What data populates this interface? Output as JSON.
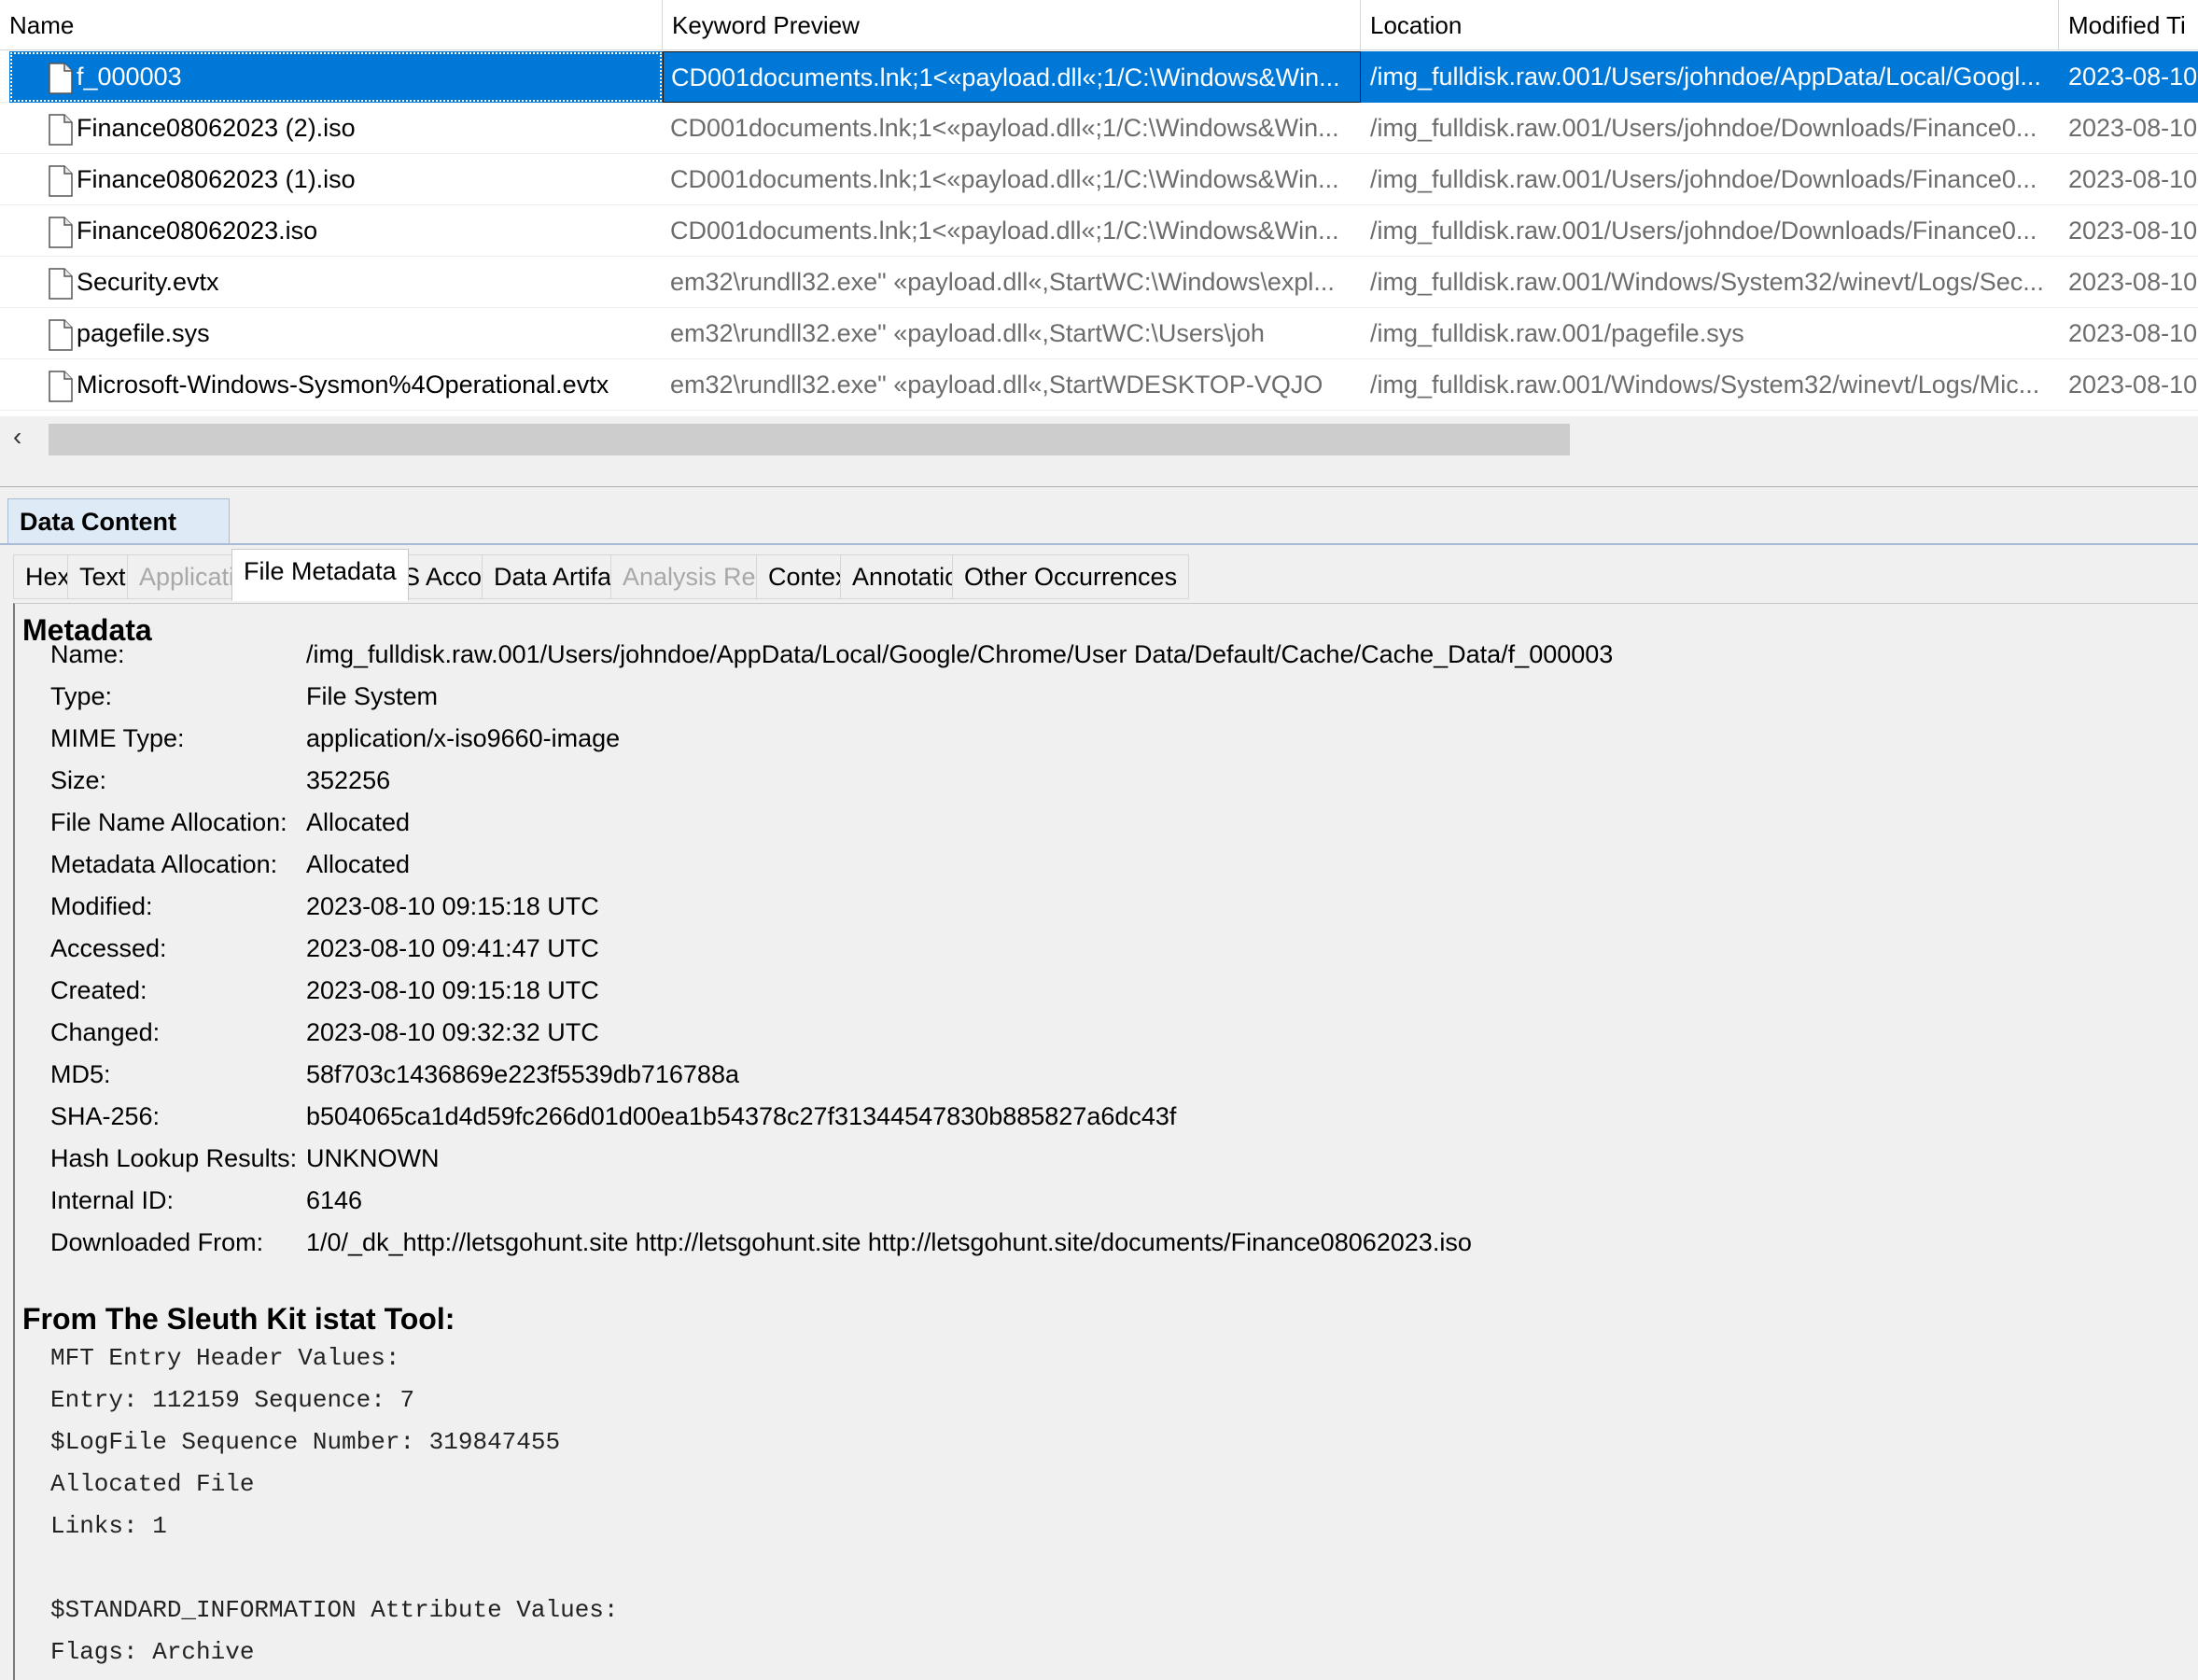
{
  "table": {
    "columns": [
      "Name",
      "Keyword Preview",
      "Location",
      "Modified Ti"
    ],
    "rows": [
      {
        "name": "f_000003",
        "keyword": "CD001documents.lnk;1<«payload.dll«;1/C:\\Windows&Win...",
        "location": "/img_fulldisk.raw.001/Users/johndoe/AppData/Local/Googl...",
        "modified": "2023-08-10"
      },
      {
        "name": "Finance08062023 (2).iso",
        "keyword": "CD001documents.lnk;1<«payload.dll«;1/C:\\Windows&Win...",
        "location": "/img_fulldisk.raw.001/Users/johndoe/Downloads/Finance0...",
        "modified": "2023-08-10"
      },
      {
        "name": "Finance08062023 (1).iso",
        "keyword": "CD001documents.lnk;1<«payload.dll«;1/C:\\Windows&Win...",
        "location": "/img_fulldisk.raw.001/Users/johndoe/Downloads/Finance0...",
        "modified": "2023-08-10"
      },
      {
        "name": "Finance08062023.iso",
        "keyword": "CD001documents.lnk;1<«payload.dll«;1/C:\\Windows&Win...",
        "location": "/img_fulldisk.raw.001/Users/johndoe/Downloads/Finance0...",
        "modified": "2023-08-10"
      },
      {
        "name": "Security.evtx",
        "keyword": "em32\\rundll32.exe\" «payload.dll«,StartWC:\\Windows\\expl...",
        "location": "/img_fulldisk.raw.001/Windows/System32/winevt/Logs/Sec...",
        "modified": "2023-08-10"
      },
      {
        "name": "pagefile.sys",
        "keyword": "em32\\rundll32.exe\" «payload.dll«,StartWC:\\Users\\joh",
        "location": "/img_fulldisk.raw.001/pagefile.sys",
        "modified": "2023-08-10"
      },
      {
        "name": "Microsoft-Windows-Sysmon%4Operational.evtx",
        "keyword": "em32\\rundll32.exe\" «payload.dll«,StartWDESKTOP-VQJO",
        "location": "/img_fulldisk.raw.001/Windows/System32/winevt/Logs/Mic...",
        "modified": "2023-08-10"
      }
    ]
  },
  "scroll": {
    "left_arrow": "‹"
  },
  "panel": {
    "title": "Data Content",
    "tabs": [
      {
        "label": "Hex",
        "state": "normal"
      },
      {
        "label": "Text",
        "state": "normal"
      },
      {
        "label": "Application",
        "state": "disabled"
      },
      {
        "label": "File Metadata",
        "state": "active"
      },
      {
        "label": "OS Account",
        "state": "normal"
      },
      {
        "label": "Data Artifacts",
        "state": "normal"
      },
      {
        "label": "Analysis Results",
        "state": "disabled"
      },
      {
        "label": "Context",
        "state": "normal"
      },
      {
        "label": "Annotations",
        "state": "normal"
      },
      {
        "label": "Other Occurrences",
        "state": "normal"
      }
    ]
  },
  "metadata": {
    "heading": "Metadata",
    "fields": [
      {
        "label": "Name:",
        "value": "/img_fulldisk.raw.001/Users/johndoe/AppData/Local/Google/Chrome/User Data/Default/Cache/Cache_Data/f_000003"
      },
      {
        "label": "Type:",
        "value": "File System"
      },
      {
        "label": "MIME Type:",
        "value": "application/x-iso9660-image"
      },
      {
        "label": "Size:",
        "value": "352256"
      },
      {
        "label": "File Name Allocation:",
        "value": "Allocated"
      },
      {
        "label": "Metadata Allocation:",
        "value": "Allocated"
      },
      {
        "label": "Modified:",
        "value": "2023-08-10 09:15:18 UTC"
      },
      {
        "label": "Accessed:",
        "value": "2023-08-10 09:41:47 UTC"
      },
      {
        "label": "Created:",
        "value": "2023-08-10 09:15:18 UTC"
      },
      {
        "label": "Changed:",
        "value": "2023-08-10 09:32:32 UTC"
      },
      {
        "label": "MD5:",
        "value": "58f703c1436869e223f5539db716788a"
      },
      {
        "label": "SHA-256:",
        "value": "b504065ca1d4d59fc266d01d00ea1b54378c27f31344547830b885827a6dc43f"
      },
      {
        "label": "Hash Lookup Results:",
        "value": "UNKNOWN"
      },
      {
        "label": "Internal ID:",
        "value": "6146"
      },
      {
        "label": "Downloaded From:",
        "value": "1/0/_dk_http://letsgohunt.site http://letsgohunt.site http://letsgohunt.site/documents/Finance08062023.iso"
      }
    ]
  },
  "istat": {
    "heading": "From The Sleuth Kit istat Tool:",
    "lines": [
      "MFT Entry Header Values:",
      "Entry: 112159 Sequence: 7",
      "$LogFile Sequence Number: 319847455",
      "Allocated File",
      "Links: 1",
      "",
      "$STANDARD_INFORMATION Attribute Values:",
      "Flags: Archive"
    ]
  },
  "colors": {
    "selection": "#0078d7",
    "disabled_text": "#a8a8a8",
    "panel_tab": "#dfeaf7"
  },
  "icons": {
    "file": "file-icon",
    "scroll_left": "chevron-left-icon"
  }
}
